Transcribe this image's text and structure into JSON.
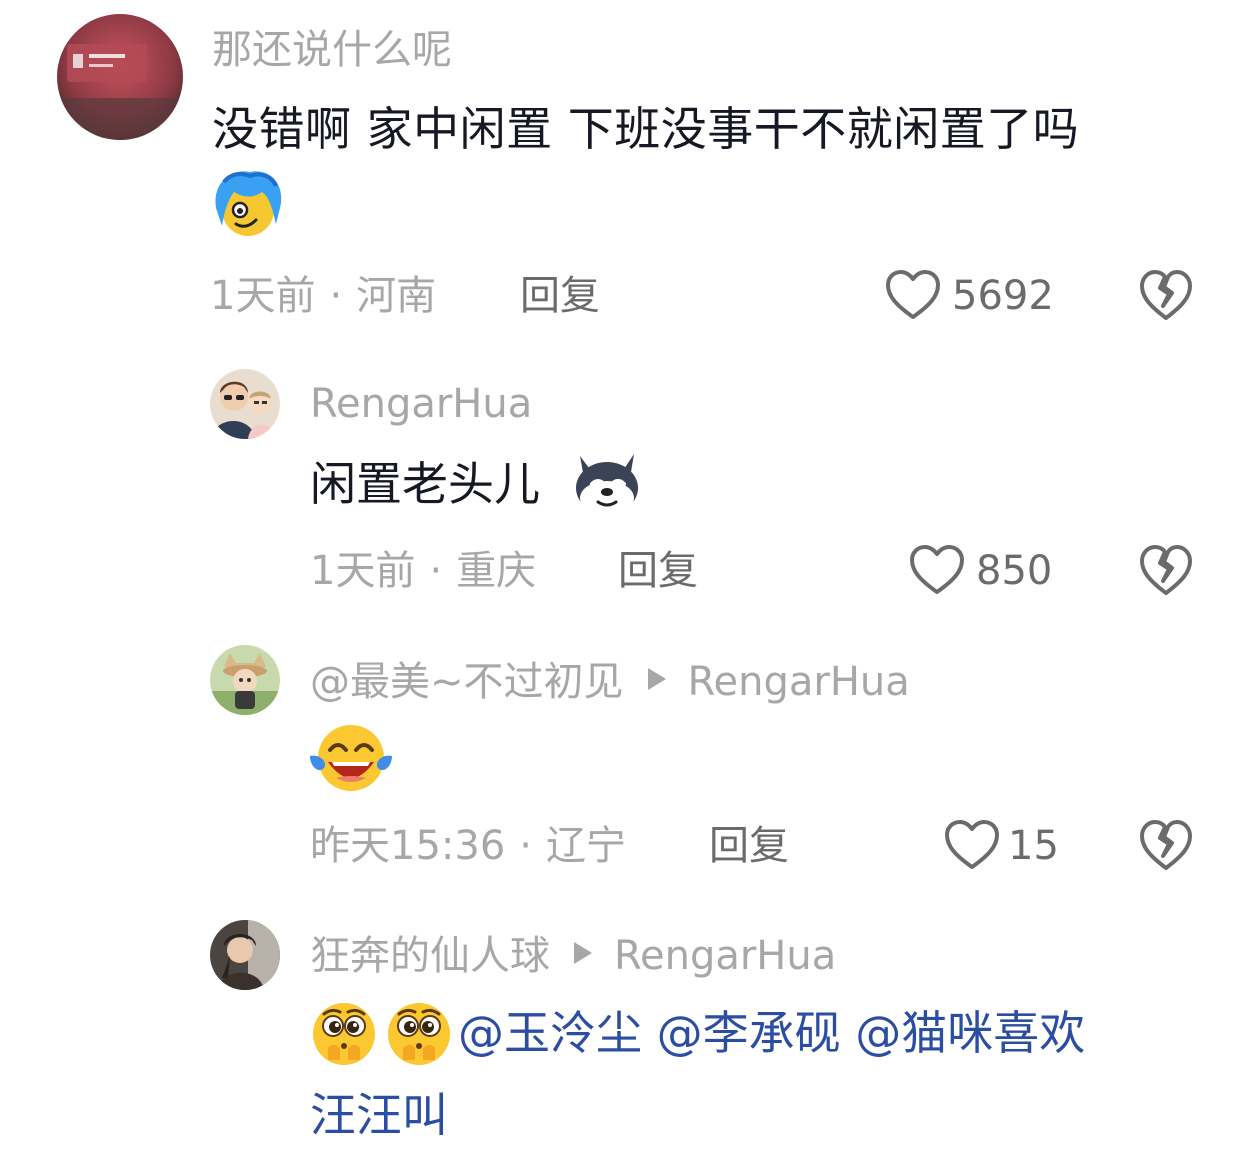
{
  "comment_main": {
    "username": "那还说什么呢",
    "text": "没错啊 家中闲置 下班没事干不就闲置了吗",
    "emoji": "blue-hair-smile-emoji",
    "time": "1天前",
    "location": "河南",
    "reply_label": "回复",
    "likes": "5692"
  },
  "reply_1": {
    "username": "RengarHua",
    "text": "闲置老头儿",
    "emoji": "husky-dog-emoji",
    "time": "1天前",
    "location": "重庆",
    "reply_label": "回复",
    "likes": "850"
  },
  "reply_2": {
    "username": "@最美~不过初见",
    "reply_to": "RengarHua",
    "emoji": "laugh-cry-emoji",
    "time": "昨天15:36",
    "location": "辽宁",
    "reply_label": "回复",
    "likes": "15"
  },
  "reply_3": {
    "username": "狂奔的仙人球",
    "reply_to": "RengarHua",
    "emoji": "pleading-emoji",
    "mention_1": "@玉泠尘",
    "mention_2": "@李承砚",
    "mention_3": "@猫咪喜欢",
    "mention_3_cont": "汪汪叫"
  },
  "separator": "·",
  "icons": {
    "like": "heart-outline-icon",
    "dislike": "broken-heart-icon",
    "reply_arrow": "play-arrow-icon"
  },
  "colors": {
    "text": "#161823",
    "secondary": "#a7a7a7",
    "action": "#6b6b6b",
    "mention": "#2b4ea2"
  }
}
